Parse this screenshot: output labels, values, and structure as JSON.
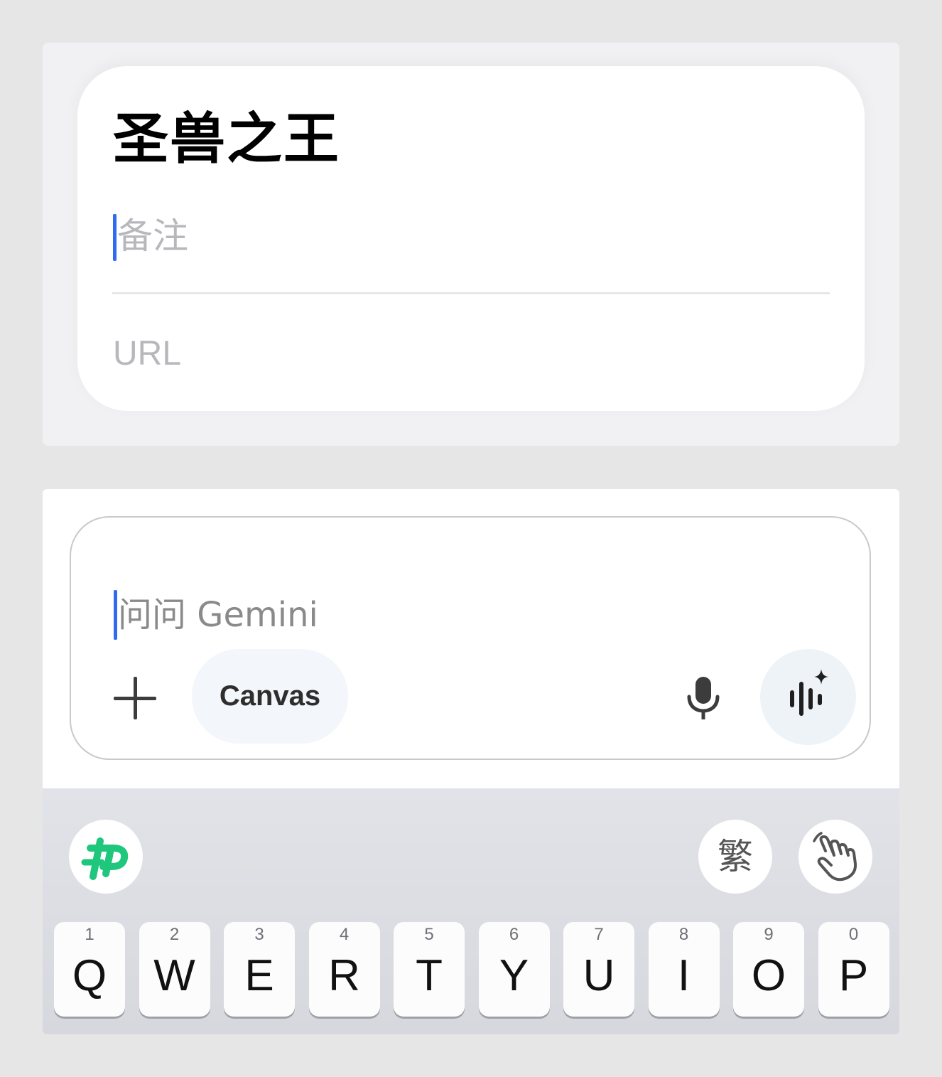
{
  "reminder": {
    "title": "圣兽之王",
    "notes_placeholder": "备注",
    "url_placeholder": "URL"
  },
  "gemini": {
    "input_placeholder": "问问 Gemini",
    "canvas_label": "Canvas",
    "add_icon": "plus-icon",
    "mic_icon": "mic-icon",
    "live_icon": "gemini-live-icon"
  },
  "keyboard": {
    "toolbar": {
      "logo_icon": "input-method-logo-icon",
      "traditional_label": "繁",
      "handwriting_icon": "handwriting-icon"
    },
    "row1": [
      {
        "num": "1",
        "char": "Q"
      },
      {
        "num": "2",
        "char": "W"
      },
      {
        "num": "3",
        "char": "E"
      },
      {
        "num": "4",
        "char": "R"
      },
      {
        "num": "5",
        "char": "T"
      },
      {
        "num": "6",
        "char": "Y"
      },
      {
        "num": "7",
        "char": "U"
      },
      {
        "num": "8",
        "char": "I"
      },
      {
        "num": "9",
        "char": "O"
      },
      {
        "num": "0",
        "char": "P"
      }
    ]
  },
  "colors": {
    "cursor": "#2f6bf1",
    "logo_green": "#1ec77c"
  }
}
